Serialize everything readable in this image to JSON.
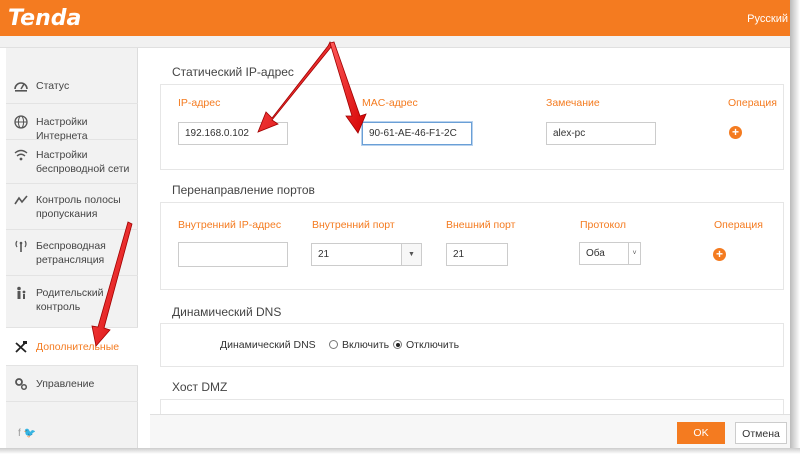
{
  "header": {
    "logo": "Tenda",
    "language": "Русский"
  },
  "sidebar": {
    "items": [
      {
        "label": "Статус",
        "icon": "dashboard-icon"
      },
      {
        "label": "Настройки Интернета",
        "icon": "globe-icon"
      },
      {
        "label": "Настройки беспроводной сети",
        "icon": "wifi-icon"
      },
      {
        "label": "Контроль полосы пропускания",
        "icon": "bandwidth-icon"
      },
      {
        "label": "Беспроводная ретрансляция",
        "icon": "repeater-icon"
      },
      {
        "label": "Родительский контроль",
        "icon": "parental-icon"
      },
      {
        "label": "Дополнительные",
        "icon": "tools-icon"
      },
      {
        "label": "Управление",
        "icon": "gear-icon"
      }
    ],
    "social": "f  🐦"
  },
  "static_ip": {
    "title": "Статический IP-адрес",
    "headers": {
      "ip": "IP-адрес",
      "mac": "MAC-адрес",
      "note": "Замечание",
      "op": "Операция"
    },
    "values": {
      "ip": "192.168.0.102",
      "mac": "90-61-AE-46-F1-2C",
      "note": "alex-pc"
    }
  },
  "port_forward": {
    "title": "Перенаправление портов",
    "headers": {
      "internal_ip": "Внутренний IP-адрес",
      "internal_port": "Внутренний порт",
      "external_port": "Внешний порт",
      "protocol": "Протокол",
      "op": "Операция"
    },
    "values": {
      "internal_ip": "",
      "internal_port": "21",
      "external_port": "21",
      "protocol": "Оба"
    }
  },
  "ddns": {
    "title": "Динамический DNS",
    "label": "Динамический DNS",
    "enable": "Включить",
    "disable": "Отключить",
    "selected": "disable"
  },
  "dmz": {
    "title": "Хост DMZ"
  },
  "footer": {
    "ok": "OK",
    "cancel": "Отмена"
  },
  "colors": {
    "accent": "#f47b20",
    "arrow": "#e01010"
  }
}
